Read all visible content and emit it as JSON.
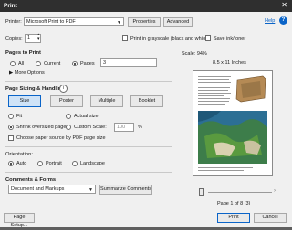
{
  "window": {
    "title": "Print",
    "close_glyph": "✕"
  },
  "printer": {
    "label": "Printer:",
    "value": "Microsoft Print to PDF",
    "properties": "Properties",
    "advanced": "Advanced",
    "help": "Help",
    "help_icon": "help-icon"
  },
  "copies": {
    "label": "Copies:",
    "value": "1",
    "grayscale": "Print in grayscale (black and white)",
    "save_ink": "Save ink/toner"
  },
  "pages_to_print": {
    "heading": "Pages to Print",
    "all": "All",
    "current": "Current",
    "pages": "Pages",
    "pages_value": "3",
    "more": "More Options"
  },
  "sizing": {
    "heading": "Page Sizing & Handling",
    "size": "Size",
    "poster": "Poster",
    "multiple": "Multiple",
    "booklet": "Booklet",
    "fit": "Fit",
    "actual": "Actual size",
    "shrink": "Shrink oversized pages",
    "custom": "Custom Scale:",
    "custom_value": "100",
    "percent": "%",
    "choose_source": "Choose paper source by PDF page size"
  },
  "orientation": {
    "heading": "Orientation:",
    "auto": "Auto",
    "portrait": "Portrait",
    "landscape": "Landscape"
  },
  "comments": {
    "heading": "Comments & Forms",
    "value": "Document and Markups",
    "summarize": "Summarize Comments"
  },
  "preview": {
    "scale": "Scale: 94%",
    "paper": "8.5 x 11 Inches",
    "page_info": "Page 1 of 8 (3)"
  },
  "footer": {
    "page_setup": "Page Setup...",
    "print": "Print",
    "cancel": "Cancel"
  },
  "colors": {
    "accent": "#0a64c8",
    "selected_size": "#cfe3f7"
  }
}
